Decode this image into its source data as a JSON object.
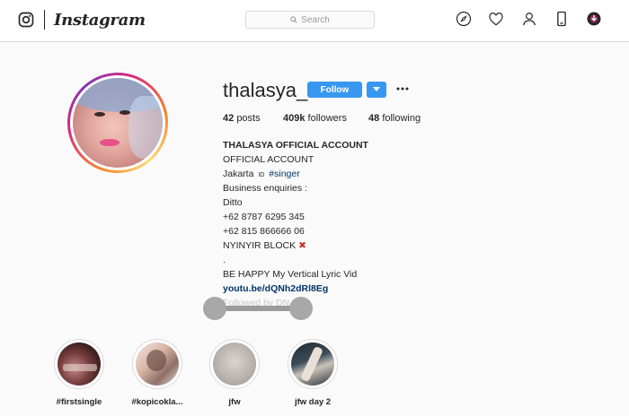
{
  "nav": {
    "logo_text": "Instagram",
    "search_placeholder": "Search",
    "icons": [
      "instagram-glyph-icon",
      "compass-icon",
      "heart-icon",
      "profile-icon",
      "mobile-icon",
      "download-icon"
    ]
  },
  "profile": {
    "username": "thalasya_",
    "follow_label": "Follow",
    "stats": {
      "posts_count": "42",
      "posts_label": "posts",
      "followers_count": "409k",
      "followers_label": "followers",
      "following_count": "48",
      "following_label": "following"
    },
    "bio": {
      "full_name": "THALASYA OFFICIAL ACCOUNT",
      "line_1": "OFFICIAL ACCOUNT",
      "location_text": "Jakarta",
      "location_flag": "ID",
      "hashtag": "#singer",
      "line_3": "Business enquiries :",
      "line_4": "Ditto",
      "phone_1": "+62 8787 6295 345",
      "phone_2": "+62 815 866666 06",
      "line_7": "NYINYIR BLOCK",
      "line_8": ".",
      "line_9": "BE HAPPY My Vertical Lyric Vid",
      "link": "youtu.be/dQNh2dRl8Eg",
      "followed_by_partial": "Followed by DN"
    }
  },
  "highlights": [
    {
      "label": "#firstsingle"
    },
    {
      "label": "#kopicokla..."
    },
    {
      "label": "jfw"
    },
    {
      "label": "jfw day 2"
    }
  ],
  "colors": {
    "accent": "#3897f0",
    "link": "#003569",
    "border": "#dbdbdb",
    "background": "#fafafa"
  }
}
